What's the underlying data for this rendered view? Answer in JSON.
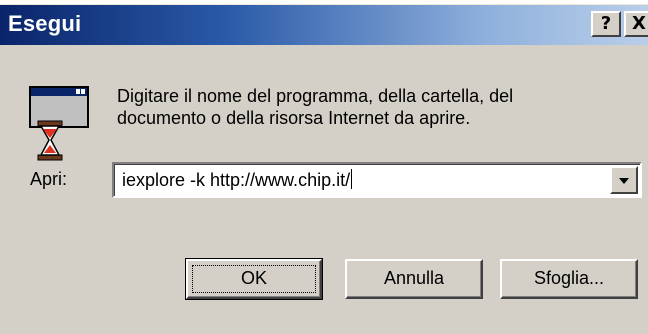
{
  "window": {
    "title": "Esegui",
    "help_label": "?",
    "close_label": "X"
  },
  "dialog": {
    "description_line1": "Digitare il nome del programma, della cartella, del",
    "description_line2": "documento o della risorsa Internet da aprire.",
    "open_label": "Apri:",
    "open_value": "iexplore -k http://www.chip.it/"
  },
  "buttons": {
    "ok": "OK",
    "cancel": "Annulla",
    "browse": "Sfoglia..."
  },
  "icons": {
    "run": "run-program-icon",
    "dropdown": "chevron-down-icon"
  },
  "colors": {
    "title_start": "#0a246a",
    "title_end": "#b9cfe9",
    "face": "#d4d0c8"
  }
}
